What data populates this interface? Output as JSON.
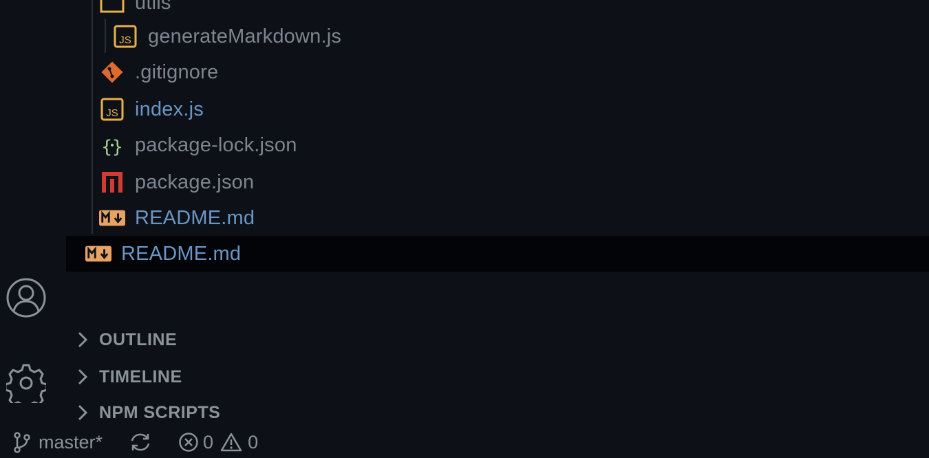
{
  "explorer": {
    "files": [
      {
        "name": "utils",
        "icon": "folder-icon"
      },
      {
        "name": "generateMarkdown.js",
        "icon": "javascript-icon"
      },
      {
        "name": ".gitignore",
        "icon": "git-icon"
      },
      {
        "name": "index.js",
        "icon": "javascript-icon"
      },
      {
        "name": "package-lock.json",
        "icon": "json-icon"
      },
      {
        "name": "package.json",
        "icon": "npm-icon"
      },
      {
        "name": "README.md",
        "icon": "markdown-icon"
      },
      {
        "name": "README.md",
        "icon": "markdown-icon"
      }
    ]
  },
  "sections": {
    "outline": "OUTLINE",
    "timeline": "TIMELINE",
    "npm_scripts": "NPM SCRIPTS"
  },
  "status": {
    "branch": "master*",
    "errors": "0",
    "warnings": "0"
  },
  "colors": {
    "background": "#0d1117",
    "selected_row": "#020408",
    "modified_text": "#6a96c6",
    "js_icon": "#e8b04a",
    "git_icon": "#e06a2c",
    "json_icon": "#a6d38a",
    "npm_icon": "#d43a33",
    "markdown_icon": "#e8a264"
  }
}
